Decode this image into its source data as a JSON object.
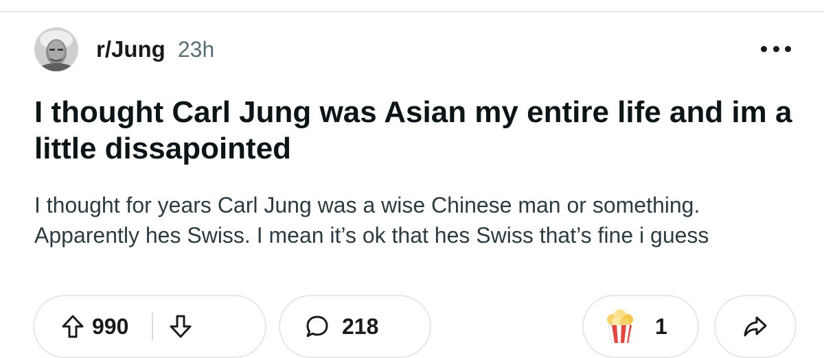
{
  "post": {
    "subreddit": "r/Jung",
    "time_ago": "23h",
    "title": "I thought Carl Jung was Asian my entire life and im a little dissapointed",
    "body": "I thought for years Carl Jung was a wise Chinese man or something. Apparently hes Swiss. I mean it’s ok that hes Swiss that’s fine i guess"
  },
  "actions": {
    "score": "990",
    "comments": "218",
    "awards": "1"
  },
  "icons": {
    "avatar": "subreddit-avatar-photo",
    "more": "more-options-icon",
    "upvote": "upvote-arrow-icon",
    "downvote": "downvote-arrow-icon",
    "comment": "comment-bubble-icon",
    "award": "popcorn-award-icon",
    "share": "share-arrow-icon"
  }
}
